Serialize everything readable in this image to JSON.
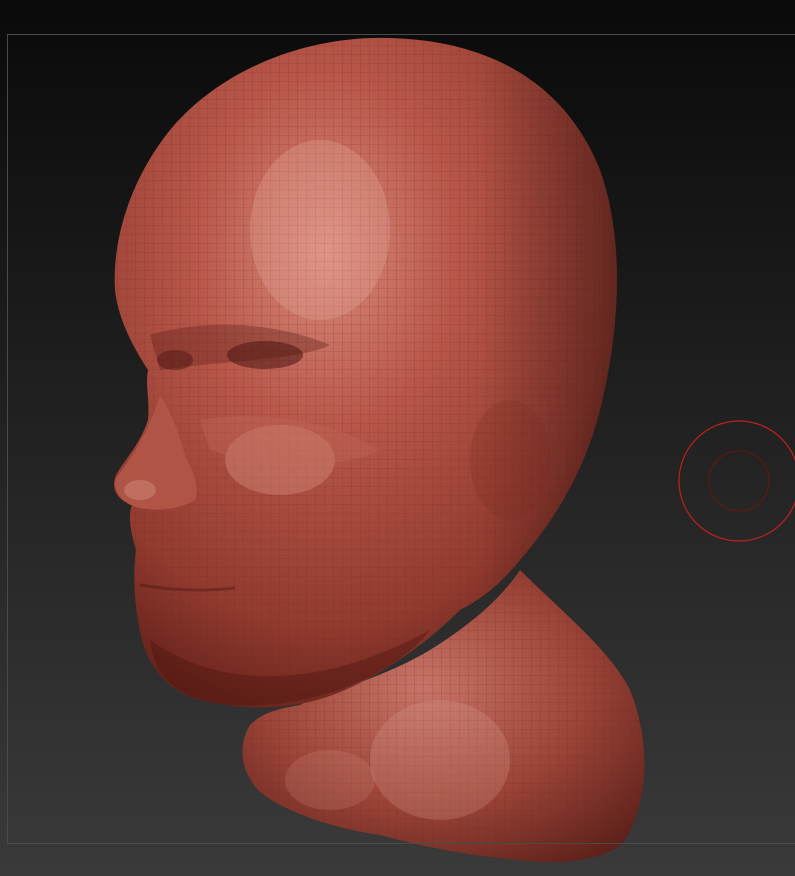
{
  "viewport": {
    "background_top": "#0a0a0a",
    "background_bottom": "#3a3a3a",
    "frame_color": "#4a4a4a"
  },
  "model": {
    "icon": "sculpt-head-mesh",
    "material_base": "#a8473a",
    "material_highlight": "#d98a7c",
    "material_shadow": "#5a1d16",
    "wire_color": "#7a2a20"
  },
  "brush": {
    "icon": "brush-cursor-icon",
    "outer_color": "#c0201a",
    "inner_color": "#6a1510"
  }
}
